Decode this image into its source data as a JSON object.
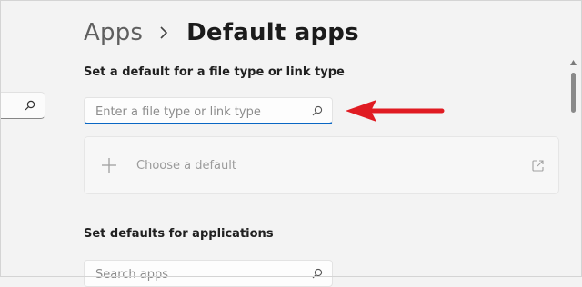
{
  "breadcrumb": {
    "parent": "Apps",
    "current": "Default apps"
  },
  "file_type_section": {
    "label": "Set a default for a file type or link type",
    "search_placeholder": "Enter a file type or link type"
  },
  "choose_default": {
    "label": "Choose a default"
  },
  "apps_section": {
    "label": "Set defaults for applications",
    "search_placeholder": "Search apps"
  },
  "colors": {
    "accent": "#0a67c4",
    "annotation_arrow": "#e01b22"
  },
  "icons": [
    "search-icon",
    "chevron-right-icon",
    "plus-icon",
    "open-external-icon",
    "scroll-up-icon"
  ]
}
